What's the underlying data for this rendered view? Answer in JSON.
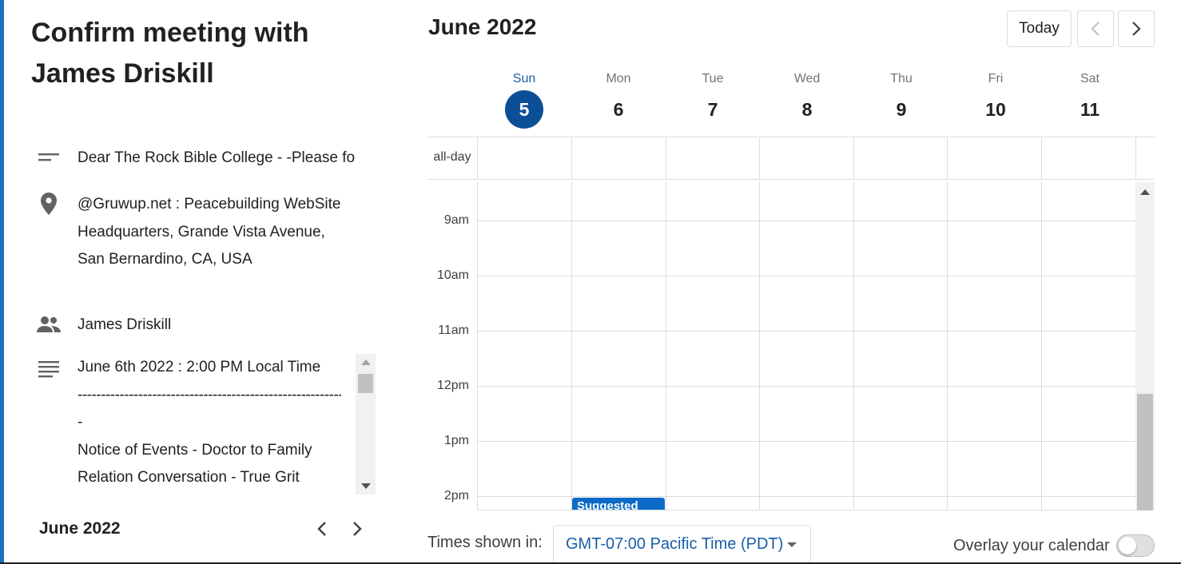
{
  "event": {
    "title": "Confirm meeting with James Driskill",
    "description": "Dear The Rock Bible College - -Please fo",
    "location_lines": [
      "@Gruwup.net : Peacebuilding WebSite",
      "Headquarters, Grande Vista Avenue,",
      "San Bernardino, CA, USA"
    ],
    "attendee": "James Driskill",
    "notes": {
      "line1": "June 6th 2022 : 2:00 PM Local Time",
      "dashes": "------------------------------------------------------------",
      "line2": "-",
      "line3": "Notice of Events - Doctor to Family",
      "line4": "Relation Conversation - True Grit"
    }
  },
  "mini_calendar": {
    "month": "June 2022"
  },
  "calendar": {
    "month": "June 2022",
    "today_label": "Today",
    "days": [
      {
        "name": "Sun",
        "date": "5",
        "today": true
      },
      {
        "name": "Mon",
        "date": "6"
      },
      {
        "name": "Tue",
        "date": "7"
      },
      {
        "name": "Wed",
        "date": "8"
      },
      {
        "name": "Thu",
        "date": "9"
      },
      {
        "name": "Fri",
        "date": "10"
      },
      {
        "name": "Sat",
        "date": "11"
      }
    ],
    "allday_label": "all-day",
    "hours": [
      "9am",
      "10am",
      "11am",
      "12pm",
      "1pm",
      "2pm"
    ],
    "suggested_event": "Suggested"
  },
  "footer": {
    "times_shown_label": "Times shown in:",
    "timezone": "GMT-07:00 Pacific Time (PDT)",
    "overlay_label": "Overlay your calendar"
  },
  "colors": {
    "accent": "#1a6fc0",
    "today_circle": "#0d4f96",
    "event": "#0b6bc7"
  }
}
